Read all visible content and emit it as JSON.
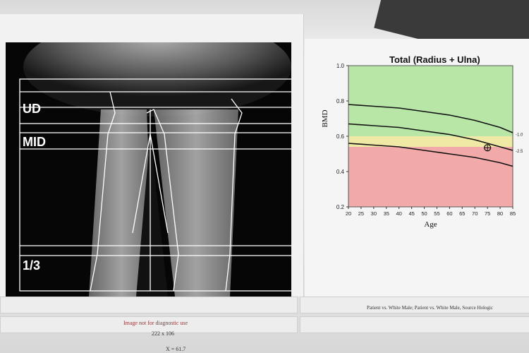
{
  "scan": {
    "labels": {
      "ud": "UD",
      "mid": "MID",
      "third": "1/3"
    }
  },
  "chart": {
    "title": "Total (Radius + Ulna)"
  },
  "chart_data": {
    "type": "line",
    "title": "Total (Radius + Ulna)",
    "xlabel": "Age",
    "ylabel": "BMD",
    "xlim": [
      20,
      85
    ],
    "ylim": [
      0.2,
      1.0
    ],
    "x_ticks": [
      "20",
      "25",
      "30",
      "35",
      "40",
      "45",
      "50",
      "55",
      "60",
      "65",
      "70",
      "75",
      "80",
      "85"
    ],
    "y_ticks": [
      "0.2",
      "0.4",
      "0.6",
      "0.8",
      "1.0"
    ],
    "right_labels": [
      "-1.0",
      "-2.5"
    ],
    "bands": [
      {
        "name": "normal",
        "from": 0.6,
        "to": 1.0,
        "color": "#b7e6a6"
      },
      {
        "name": "osteopenia",
        "from": 0.54,
        "to": 0.6,
        "color": "#f0e9a6"
      },
      {
        "name": "osteoporosis",
        "from": 0.2,
        "to": 0.54,
        "color": "#f2a9a9"
      }
    ],
    "series": [
      {
        "x": [
          20,
          30,
          40,
          50,
          60,
          70,
          80,
          85
        ],
        "values": [
          0.78,
          0.77,
          0.76,
          0.74,
          0.72,
          0.69,
          0.65,
          0.62
        ]
      },
      {
        "x": [
          20,
          30,
          40,
          50,
          60,
          70,
          80,
          85
        ],
        "values": [
          0.67,
          0.66,
          0.65,
          0.63,
          0.61,
          0.58,
          0.54,
          0.52
        ]
      },
      {
        "x": [
          20,
          30,
          40,
          50,
          60,
          70,
          80,
          85
        ],
        "values": [
          0.56,
          0.55,
          0.54,
          0.52,
          0.5,
          0.48,
          0.45,
          0.43
        ]
      }
    ],
    "patient_point": {
      "x": 75,
      "y": 0.535
    }
  },
  "footer": {
    "left_note": "Image not for diagnostic use",
    "left_dims": "222 x 106",
    "left_bottom": "X = 61.7",
    "right_note": "Patient vs. White Male; Patient vs. White Male, Source Hologic"
  }
}
